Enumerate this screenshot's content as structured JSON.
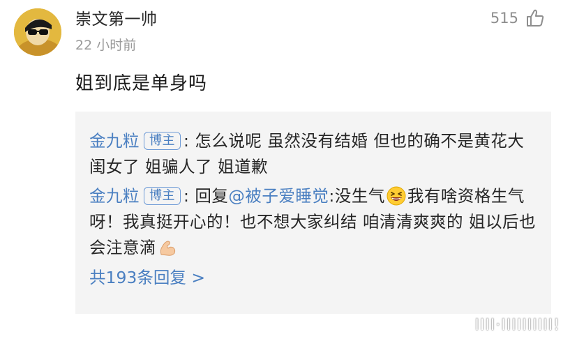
{
  "comment": {
    "author": "崇文第一帅",
    "time": "22 小时前",
    "likes": "515",
    "text": "姐到底是单身吗"
  },
  "replies": [
    {
      "name": "金九粒",
      "badge": "博主",
      "sep": ":",
      "text": " 怎么说呢 虽然没有结婚 但也的确不是黄花大闺女了 姐骗人了 姐道歉"
    },
    {
      "name": "金九粒",
      "badge": "博主",
      "sep": ":",
      "prefix": " 回复",
      "mention": "@被子爱睡觉",
      "text_a": ":没生气",
      "text_b": "我有啥资格生气呀！我真挺开心的！也不想大家纠结 咱清清爽爽的 姐以后也会注意滴",
      "emoji_a": "grinning-squint-emoji",
      "emoji_b": "flexed-biceps-emoji"
    }
  ],
  "more_replies": "共193条回复 >",
  "watermark": "IIII·IIIIIIIIII!"
}
